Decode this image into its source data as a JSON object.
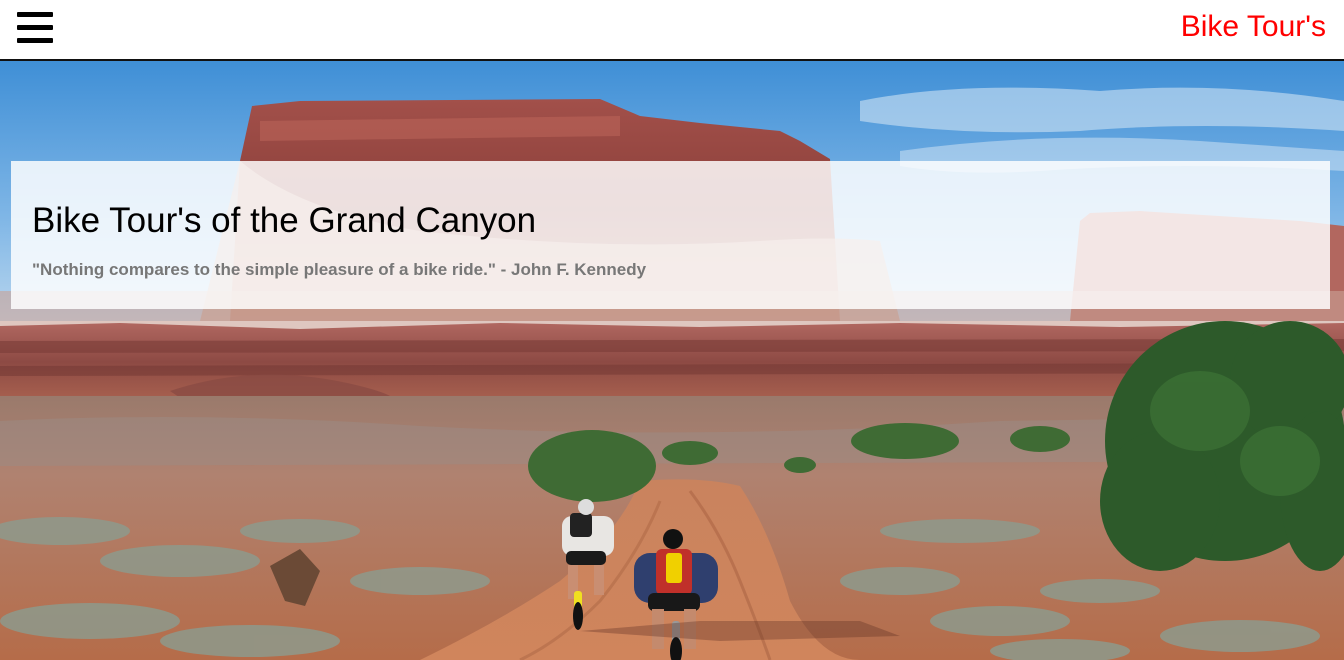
{
  "navbar": {
    "menu_icon": "hamburger-menu-icon",
    "brand": "Bike Tour's",
    "brand_color": "#ff0000"
  },
  "hero": {
    "image_description": "desert mesa with two mountain bikers riding a red dirt trail",
    "title": "Bike Tour's of the Grand Canyon",
    "quote": "\"Nothing compares to the simple pleasure of a bike ride.\" - John F. Kennedy"
  }
}
